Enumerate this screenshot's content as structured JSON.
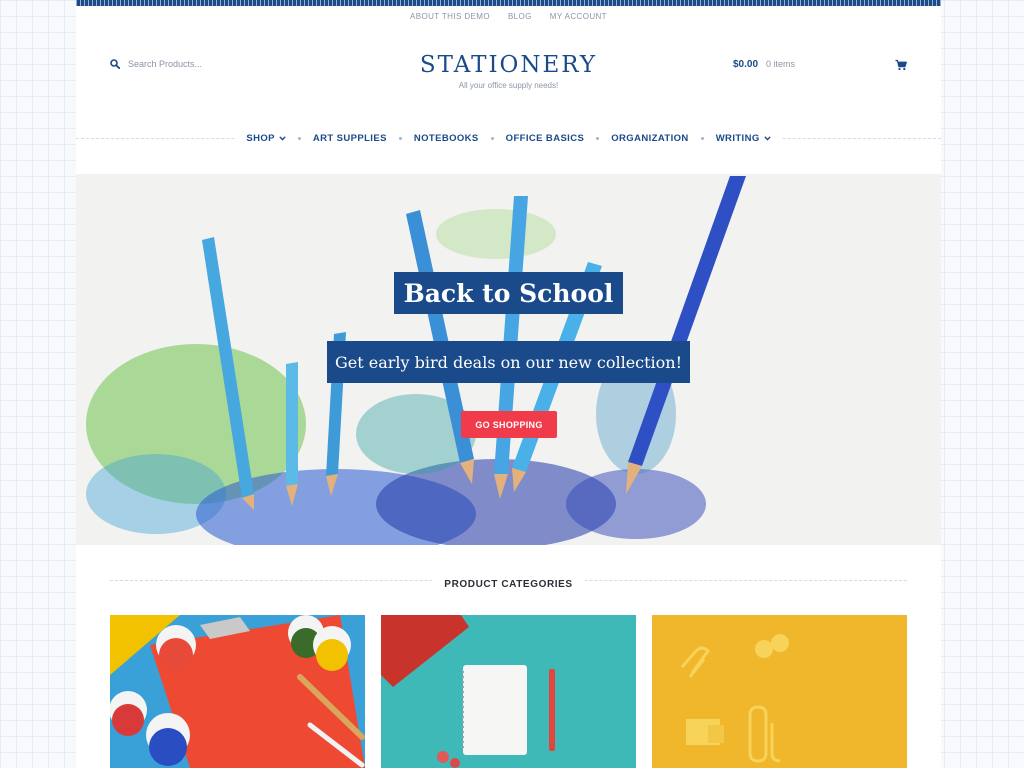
{
  "topnav": {
    "about": "ABOUT THIS DEMO",
    "blog": "BLOG",
    "account": "MY ACCOUNT"
  },
  "header": {
    "search_placeholder": "Search Products...",
    "search_icon": "search-icon",
    "site_title": "STATIONERY",
    "tagline": "All your office supply needs!",
    "cart_amount": "$0.00",
    "cart_count": "0 items",
    "cart_icon": "shopping-cart-icon"
  },
  "mainnav": {
    "items": [
      {
        "label": "SHOP",
        "has_dropdown": true
      },
      {
        "label": "ART SUPPLIES",
        "has_dropdown": false
      },
      {
        "label": "NOTEBOOKS",
        "has_dropdown": false
      },
      {
        "label": "OFFICE BASICS",
        "has_dropdown": false
      },
      {
        "label": "ORGANIZATION",
        "has_dropdown": false
      },
      {
        "label": "WRITING",
        "has_dropdown": true
      }
    ]
  },
  "hero": {
    "heading": "Back to School",
    "subheading": "Get early bird deals on our new collection!",
    "button_label": "GO SHOPPING"
  },
  "categories": {
    "title": "PRODUCT CATEGORIES"
  },
  "colors": {
    "brand": "#1b4a8a",
    "accent": "#f03b4b",
    "muted": "#8b96a6"
  }
}
